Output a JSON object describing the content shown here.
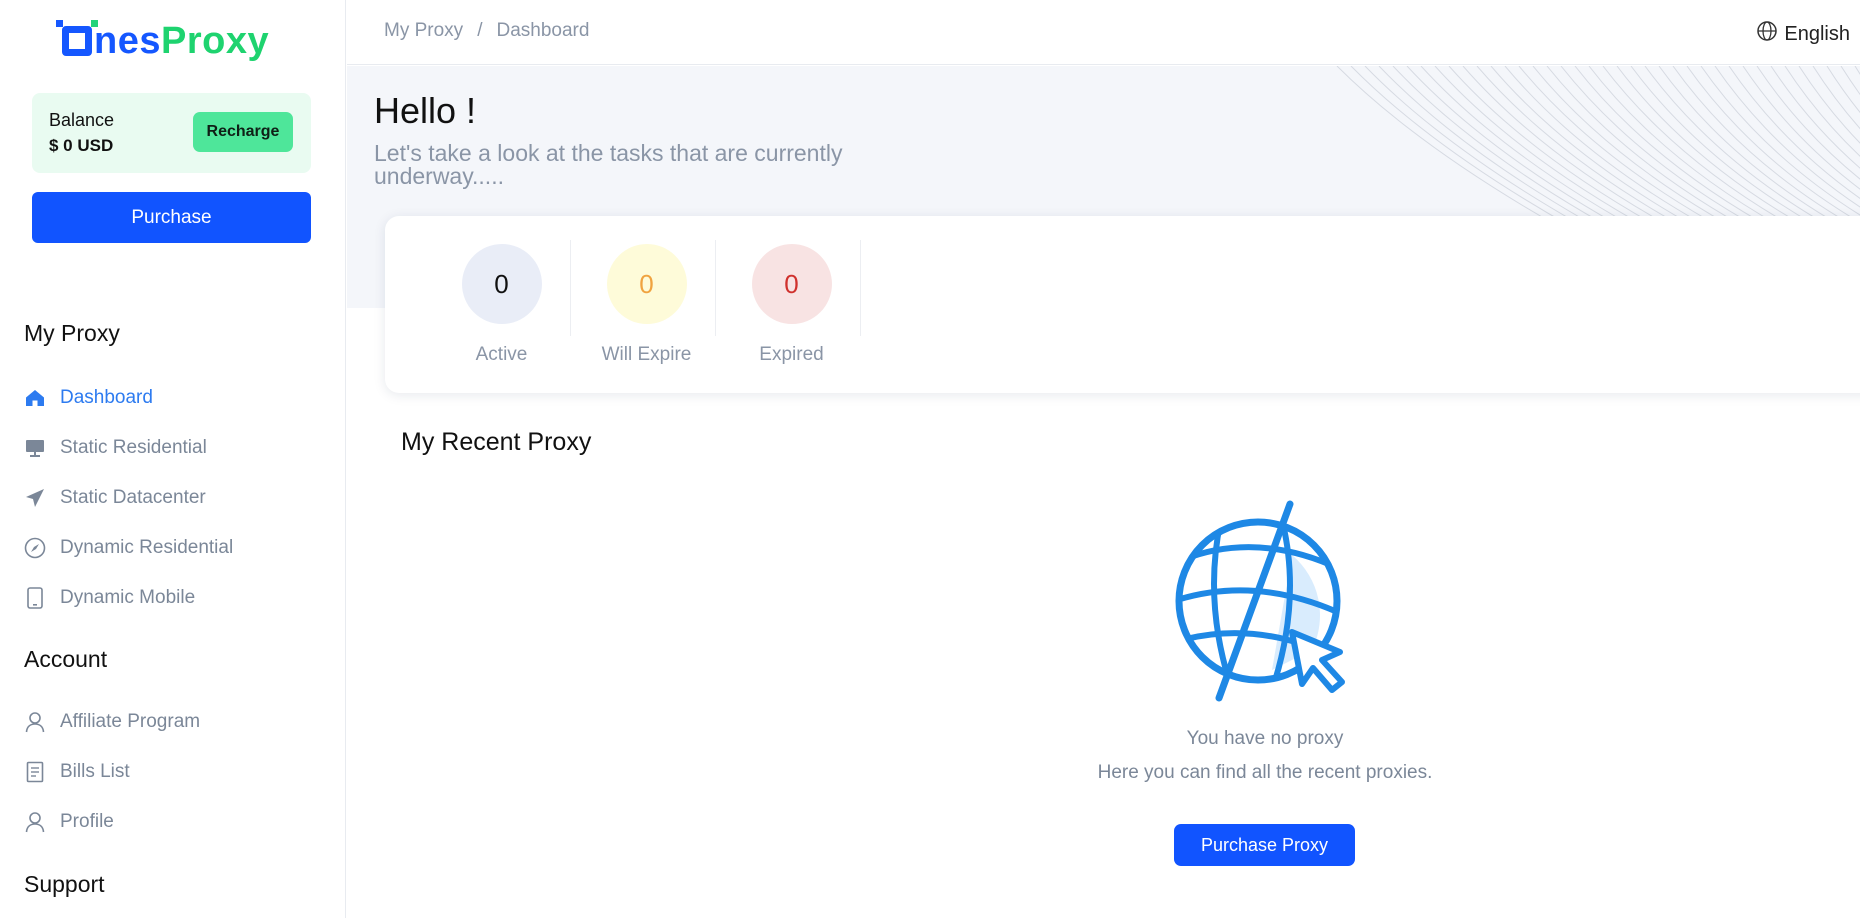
{
  "logo": {
    "part1": "nes",
    "part2": "Proxy"
  },
  "balance": {
    "label": "Balance",
    "value": "$ 0 USD",
    "recharge_label": "Recharge"
  },
  "sidebar": {
    "purchase_label": "Purchase",
    "sections": [
      {
        "title": "My Proxy"
      },
      {
        "title": "Account"
      },
      {
        "title": "Support"
      }
    ],
    "my_proxy_items": [
      {
        "label": "Dashboard",
        "icon": "home-icon",
        "active": true
      },
      {
        "label": "Static Residential",
        "icon": "monitor-icon"
      },
      {
        "label": "Static Datacenter",
        "icon": "send-icon"
      },
      {
        "label": "Dynamic Residential",
        "icon": "compass-icon"
      },
      {
        "label": "Dynamic Mobile",
        "icon": "mobile-icon"
      }
    ],
    "account_items": [
      {
        "label": "Affiliate Program",
        "icon": "user-icon"
      },
      {
        "label": "Bills List",
        "icon": "document-icon"
      },
      {
        "label": "Profile",
        "icon": "user-icon"
      }
    ]
  },
  "breadcrumb": {
    "root": "My Proxy",
    "separator": "/",
    "current": "Dashboard"
  },
  "language": {
    "label": "English",
    "icon": "globe-icon"
  },
  "hero": {
    "greeting": "Hello !",
    "subtitle": "Let's take a look at the tasks that are currently underway....."
  },
  "stats": [
    {
      "value": "0",
      "label": "Active",
      "bg": "#e9edf7",
      "color": "#111111"
    },
    {
      "value": "0",
      "label": "Will Expire",
      "bg": "#fefbd9",
      "color": "#f0a340"
    },
    {
      "value": "0",
      "label": "Expired",
      "bg": "#f8e3e3",
      "color": "#d0312d"
    }
  ],
  "recent": {
    "title": "My Recent Proxy",
    "empty_line1": "You have no proxy",
    "empty_line2": "Here you can find all the recent proxies.",
    "button_label": "Purchase Proxy"
  },
  "colors": {
    "primary": "#1154ff",
    "accent_green": "#4ee69a",
    "active_nav": "#2d7bf0"
  }
}
